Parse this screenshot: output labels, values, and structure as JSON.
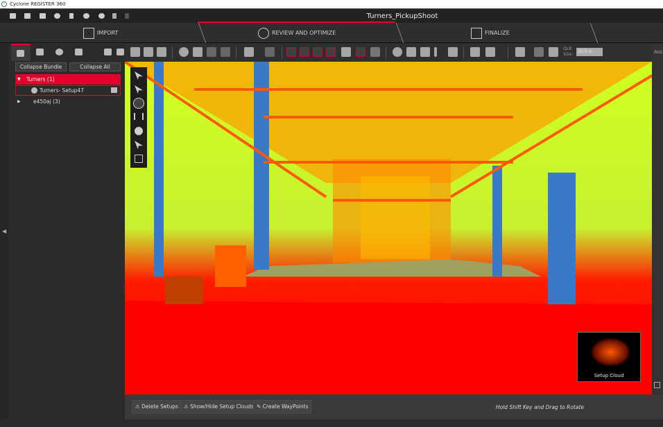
{
  "app": {
    "title": "Cyclone REGISTER 360",
    "project": "Turners_PickupShoot"
  },
  "workflow": {
    "steps": [
      {
        "label": "IMPORT"
      },
      {
        "label": "REVIEW AND OPTIMIZE",
        "active": true
      },
      {
        "label": "FINALIZE"
      }
    ]
  },
  "toolbar": {
    "qlb_label": "QLB Size:",
    "qlb_value": "10.0 m"
  },
  "left": {
    "collapse_bundle": "Collapse Bundle",
    "collapse_all": "Collapse All",
    "tree": [
      {
        "label": "Turners (1)",
        "selected": true,
        "expanded": true
      },
      {
        "label": "Turners- Setup47",
        "child": true
      },
      {
        "label": "e450aj (3)",
        "expanded": false
      }
    ]
  },
  "right": {
    "label": "Ass"
  },
  "viewport": {
    "minimap_label": "Setup Cloud",
    "colors": {
      "high": "#ff0000",
      "mid": "#ffa000",
      "low": "#c8ff20",
      "wall": "#3a78c8"
    }
  },
  "bottom": {
    "delete": "Delete Setups",
    "showhide": "Show/Hide Setup Clouds",
    "waypoints": "Create WayPoints",
    "hint": "Hold Shift Key and Drag to Rotate"
  },
  "accent": "#e4002b"
}
